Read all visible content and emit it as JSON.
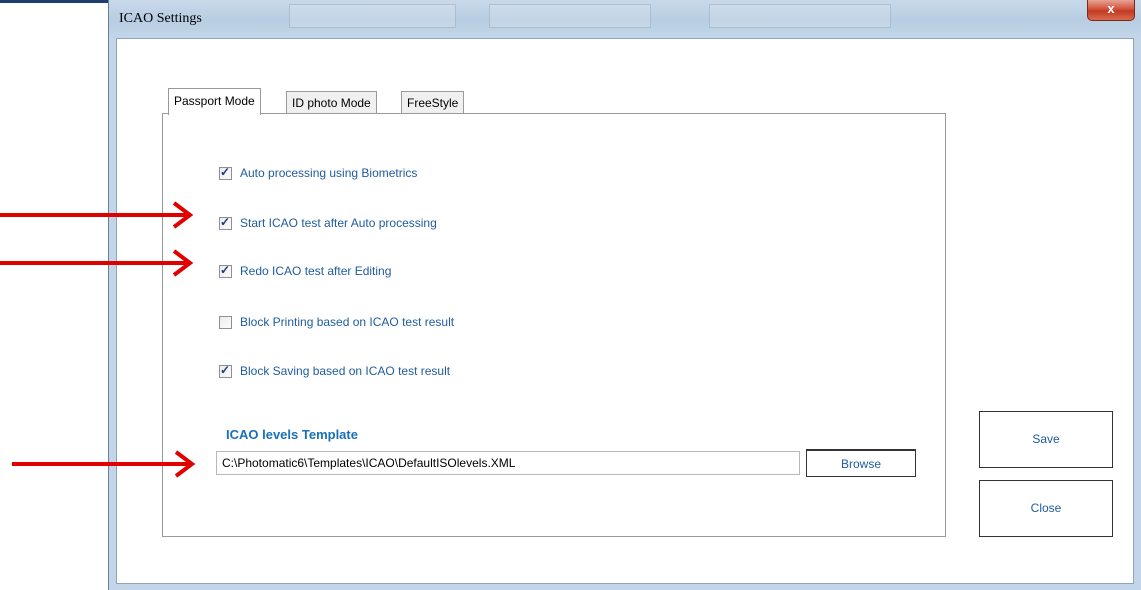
{
  "window": {
    "title": "ICAO Settings",
    "close_glyph": "x"
  },
  "tabs": [
    {
      "label": "Passport Mode",
      "active": true
    },
    {
      "label": "ID photo Mode",
      "active": false
    },
    {
      "label": "FreeStyle",
      "active": false
    }
  ],
  "options": [
    {
      "label": "Auto processing using Biometrics",
      "checked": true
    },
    {
      "label": "Start ICAO test after Auto processing",
      "checked": true
    },
    {
      "label": "Redo ICAO test after Editing",
      "checked": true
    },
    {
      "label": "Block Printing based on ICAO test result",
      "checked": false
    },
    {
      "label": "Block Saving based on ICAO test result",
      "checked": true
    }
  ],
  "template": {
    "title": "ICAO levels Template",
    "path": "C:\\Photomatic6\\Templates\\ICAO\\DefaultISOlevels.XML",
    "browse_label": "Browse"
  },
  "actions": {
    "save_label": "Save",
    "close_label": "Close"
  },
  "annotation": {
    "arrow_color": "#e00000",
    "arrow_count": 3
  },
  "colors": {
    "label_blue": "#1f5b9e",
    "section_blue": "#1a70b8"
  }
}
